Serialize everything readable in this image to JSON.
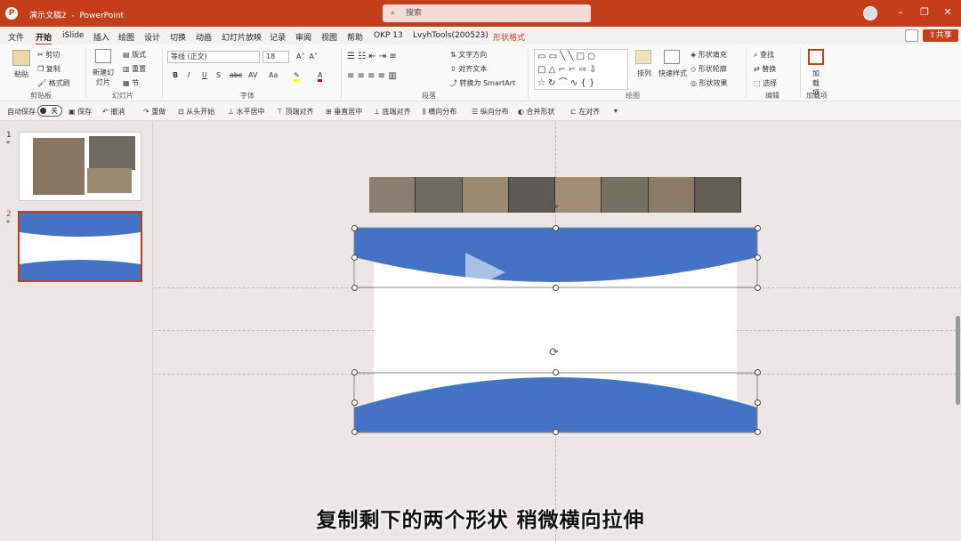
{
  "titlebar": {
    "doc_title": "演示文稿2",
    "app": "PowerPoint",
    "search_placeholder": "搜索",
    "logo": "P"
  },
  "menu": {
    "tabs": [
      "文件",
      "开始",
      "iSlide",
      "插入",
      "绘图",
      "设计",
      "切换",
      "动画",
      "幻灯片放映",
      "记录",
      "审阅",
      "视图",
      "帮助",
      "OKP 13",
      "LvyhTools(200523)",
      "形状格式"
    ],
    "active": "开始",
    "share": "共享"
  },
  "ribbon": {
    "clipboard": {
      "paste": "粘贴",
      "cut": "剪切",
      "copy": "复制",
      "format_painter": "格式刷",
      "group": "剪贴板"
    },
    "slides": {
      "new_slide": "新建幻灯片",
      "layout": "版式",
      "reset": "重置",
      "section": "节",
      "group": "幻灯片"
    },
    "font": {
      "name": "等线 (正文)",
      "size": "18",
      "group": "字体",
      "bold": "B",
      "italic": "I",
      "underline": "U",
      "shadow": "S",
      "strike": "abc",
      "spacing": "AV",
      "case": "Aa",
      "color": "A"
    },
    "paragraph": {
      "text_direction": "文字方向",
      "align_text": "对齐文本",
      "smartart": "转换为 SmartArt",
      "group": "段落"
    },
    "drawing": {
      "arrange": "排列",
      "quick_styles": "快速样式",
      "fill": "形状填充",
      "outline": "形状轮廓",
      "effects": "形状效果",
      "group": "绘图"
    },
    "editing": {
      "find": "查找",
      "replace": "替换",
      "select": "选择",
      "group": "编辑"
    },
    "addins": {
      "label": "加载项",
      "group": "加载项"
    }
  },
  "qat": {
    "autosave": "自动保存",
    "autosave_state": "关",
    "items": [
      "保存",
      "撤消",
      "重做",
      "从头开始",
      "水平居中",
      "顶端对齐",
      "垂直居中",
      "底端对齐",
      "横向分布",
      "纵向分布",
      "合并形状",
      "左对齐"
    ]
  },
  "slides": {
    "thumb_numbers": [
      "1",
      "2"
    ],
    "star": "*"
  },
  "subtitle": "复制剩下的两个形状 稍微横向拉伸",
  "colors": {
    "accent": "#c43e1c",
    "shape_blue": "#4472c4"
  },
  "icons": {
    "rotate": "⟳",
    "play": "▶",
    "search": "⌕"
  }
}
